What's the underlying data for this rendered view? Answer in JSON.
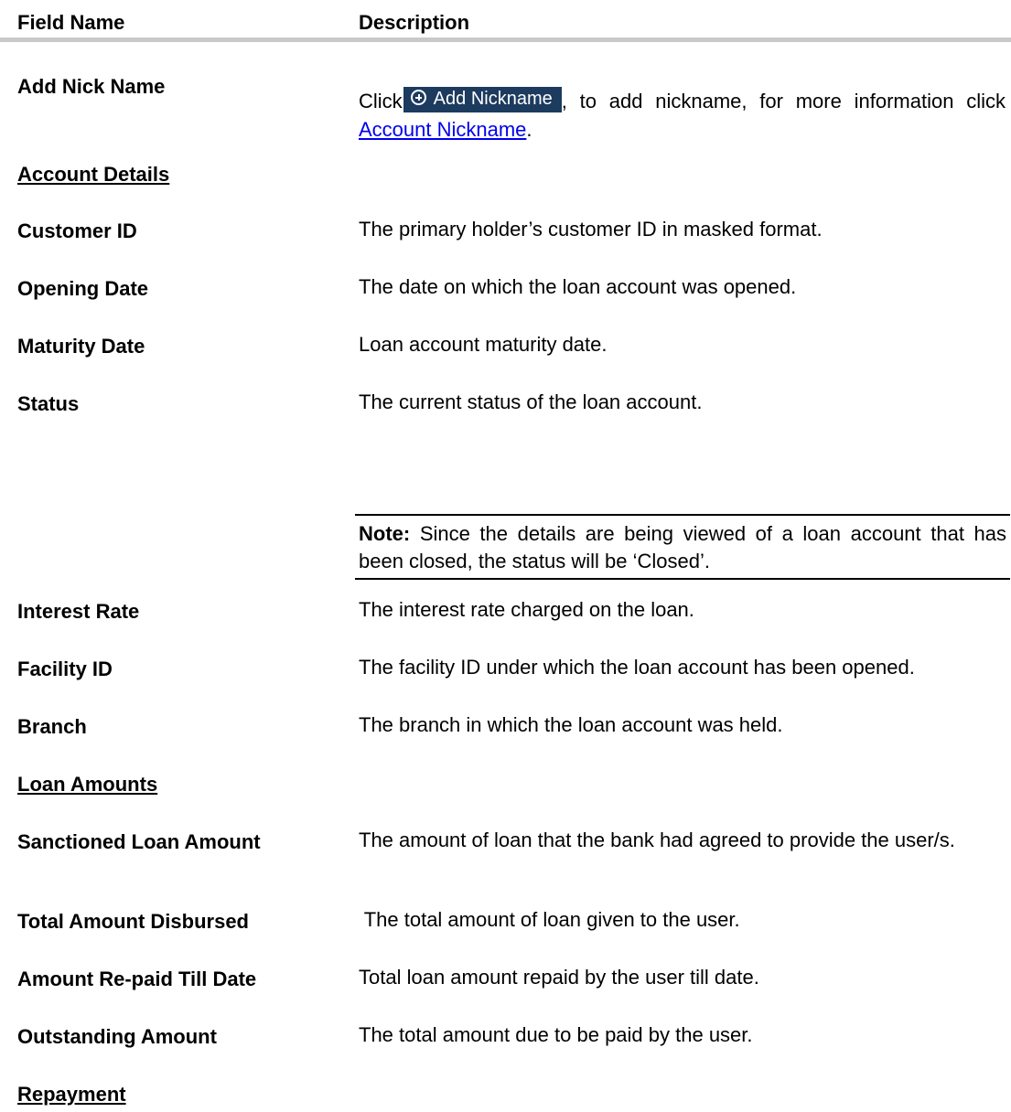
{
  "header": {
    "field_name": "Field Name",
    "description": "Description"
  },
  "add_nick_name": {
    "field": "Add Nick Name",
    "desc_prefix": "Click",
    "button_label": "Add Nickname",
    "desc_middle": ", to add nickname, for more information click",
    "link_text": "Account Nickname",
    "desc_suffix": "."
  },
  "sections": {
    "account_details": "Account Details",
    "loan_amounts": "Loan Amounts",
    "repayment": "Repayment"
  },
  "account_details_rows": [
    {
      "field": "Customer ID",
      "description": "The primary holder’s customer ID in masked format."
    },
    {
      "field": "Opening Date",
      "description": "The date on which the loan account was opened."
    },
    {
      "field": "Maturity Date",
      "description": "Loan account maturity date."
    },
    {
      "field": "Status",
      "description": "The current status of the loan account."
    },
    {
      "field": "Interest Rate",
      "description": "The interest rate charged on the loan."
    },
    {
      "field": "Facility ID",
      "description": "The facility ID under which the loan account has been opened."
    },
    {
      "field": "Branch",
      "description": "The branch in which the loan account was held."
    }
  ],
  "note": {
    "label": "Note:",
    "text": "Since the details are being viewed of a loan account that has been closed, the status will be ‘Closed’."
  },
  "loan_amount_rows": [
    {
      "field": "Sanctioned Loan Amount",
      "description": "The amount of loan that the bank had agreed to provide the user/s."
    },
    {
      "field": "Total Amount Disbursed",
      "description": " The total amount of loan given to the user."
    },
    {
      "field": "Amount Re-paid Till Date",
      "description": "Total loan amount repaid by the user till date."
    },
    {
      "field": "Outstanding Amount",
      "description": "The total amount due to be paid by the user."
    }
  ],
  "colors": {
    "button_bg": "#1c3b5e",
    "link": "#0000ee",
    "header_rule": "#c9c9c9"
  }
}
